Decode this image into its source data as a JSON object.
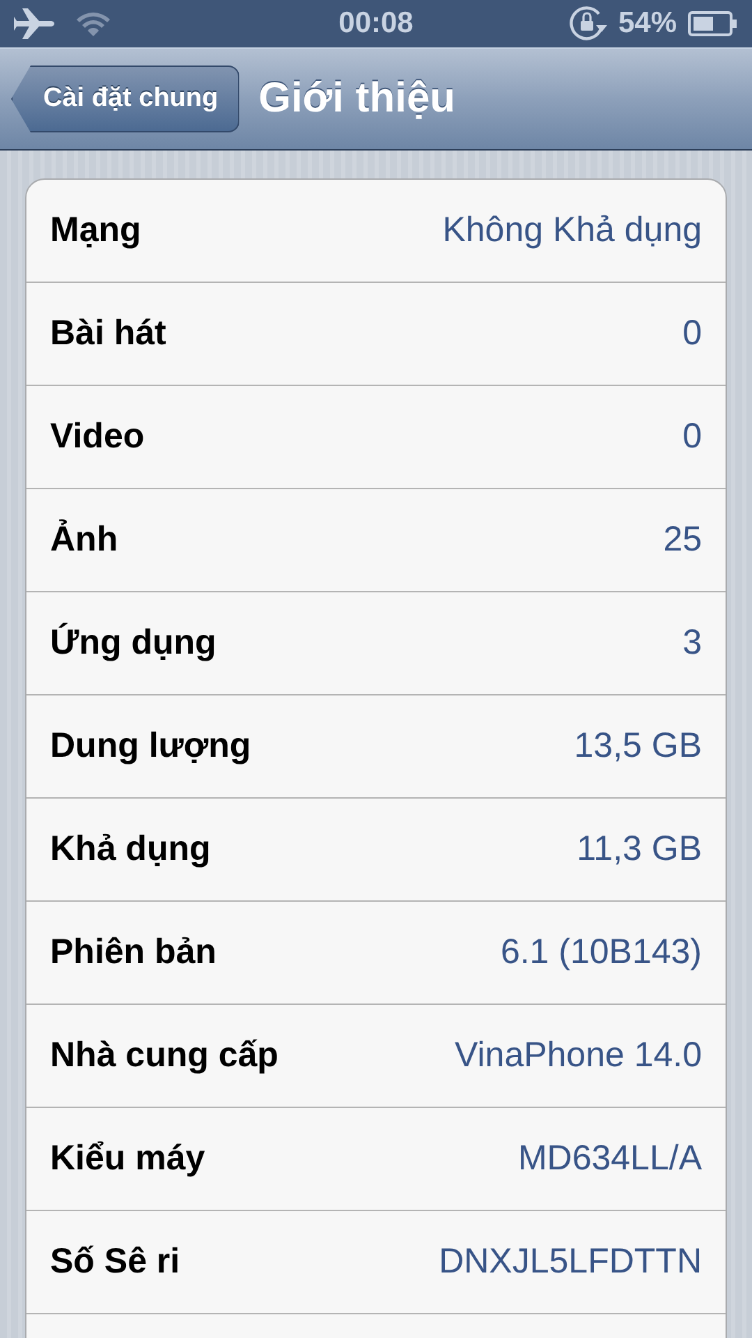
{
  "status_bar": {
    "time": "00:08",
    "battery": "54%"
  },
  "nav_bar": {
    "back": "Cài đặt chung",
    "title": "Giới thiệu"
  },
  "rows": [
    {
      "label": "Mạng",
      "value": "Không Khả dụng"
    },
    {
      "label": "Bài hát",
      "value": "0"
    },
    {
      "label": "Video",
      "value": "0"
    },
    {
      "label": "Ảnh",
      "value": "25"
    },
    {
      "label": "Ứng dụng",
      "value": "3"
    },
    {
      "label": "Dung lượng",
      "value": "13,5 GB"
    },
    {
      "label": "Khả dụng",
      "value": "11,3 GB"
    },
    {
      "label": "Phiên bản",
      "value": "6.1 (10B143)"
    },
    {
      "label": "Nhà cung cấp",
      "value": "VinaPhone 14.0"
    },
    {
      "label": "Kiểu máy",
      "value": "MD634LL/A"
    },
    {
      "label": "Số Sê ri",
      "value": "DNXJL5LFDTTN"
    }
  ]
}
